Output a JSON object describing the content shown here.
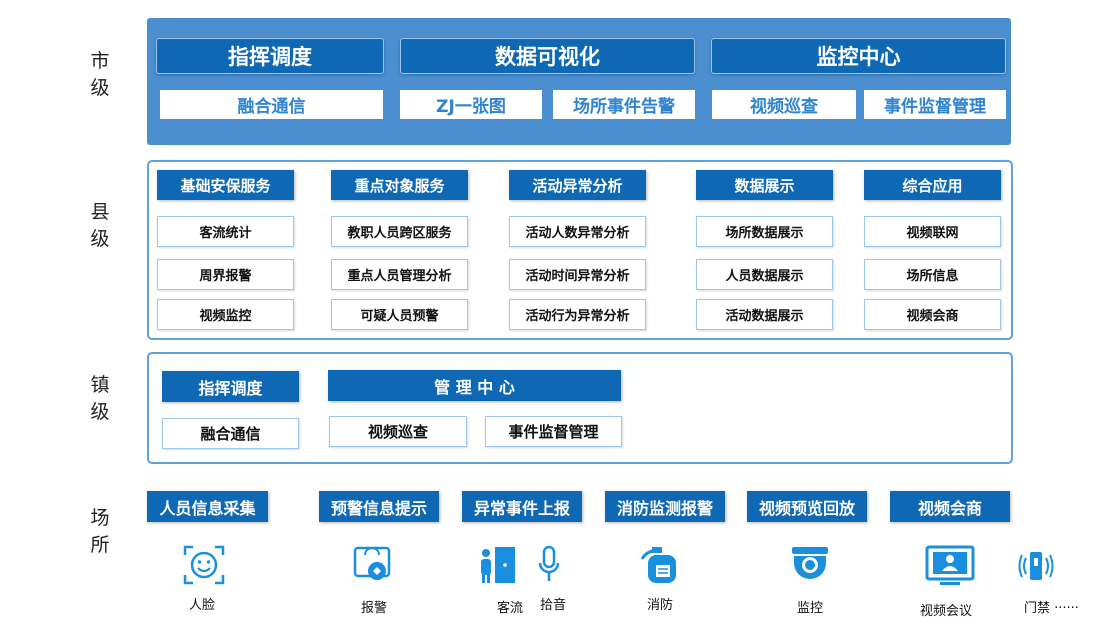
{
  "levels": {
    "city": "市级",
    "county": "县级",
    "town": "镇级",
    "venue": "场所"
  },
  "city": {
    "heads": [
      "指挥调度",
      "数据可视化",
      "监控中心"
    ],
    "subs": [
      "融合通信",
      "ZJ一张图",
      "场所事件告警",
      "视频巡查",
      "事件监督管理"
    ]
  },
  "county": {
    "columns": [
      {
        "head": "基础安保服务",
        "items": [
          "客流统计",
          "周界报警",
          "视频监控"
        ]
      },
      {
        "head": "重点对象服务",
        "items": [
          "教职人员跨区服务",
          "重点人员管理分析",
          "可疑人员预警"
        ]
      },
      {
        "head": "活动异常分析",
        "items": [
          "活动人数异常分析",
          "活动时间异常分析",
          "活动行为异常分析"
        ]
      },
      {
        "head": "数据展示",
        "items": [
          "场所数据展示",
          "人员数据展示",
          "活动数据展示"
        ]
      },
      {
        "head": "综合应用",
        "items": [
          "视频联网",
          "场所信息",
          "视频会商"
        ]
      }
    ]
  },
  "town": {
    "heads": [
      "指挥调度",
      "管 理 中 心"
    ],
    "items": [
      "融合通信",
      "视频巡查",
      "事件监督管理"
    ]
  },
  "venue": {
    "heads": [
      "人员信息采集",
      "预警信息提示",
      "异常事件上报",
      "消防监测报警",
      "视频预览回放",
      "视频会商"
    ],
    "devices": [
      {
        "icon": "face-scan-icon",
        "label": "人脸"
      },
      {
        "icon": "alarm-icon",
        "label": "报警"
      },
      {
        "icon": "people-flow-icon",
        "label": "客流"
      },
      {
        "icon": "microphone-icon",
        "label": "拾音"
      },
      {
        "icon": "fire-extinguisher-icon",
        "label": "消防"
      },
      {
        "icon": "dome-camera-icon",
        "label": "监控"
      },
      {
        "icon": "video-conference-icon",
        "label": "视频会议"
      },
      {
        "icon": "access-control-icon",
        "label": "门禁 ······"
      }
    ]
  },
  "colors": {
    "primary": "#0e68b4",
    "panel": "#4b8fd0",
    "border": "#5da3d9",
    "subText": "#2f84d0",
    "icon": "#1a8fe0"
  }
}
